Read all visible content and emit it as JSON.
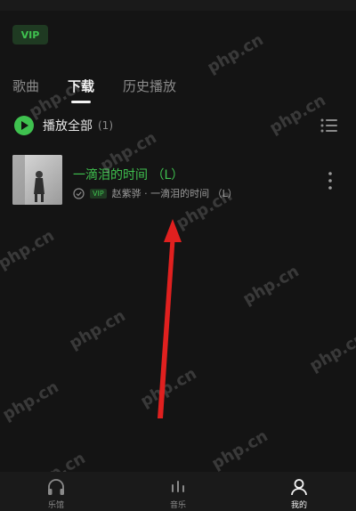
{
  "header": {
    "vip_label": "VIP"
  },
  "tabs": [
    {
      "label": "歌曲"
    },
    {
      "label": "下载"
    },
    {
      "label": "历史播放"
    }
  ],
  "play_all": {
    "label": "播放全部",
    "count": "(1)"
  },
  "song": {
    "title": "一滴泪的时间 （L）",
    "vip_tag": "VIP",
    "subtitle": "赵紫骅 · 一滴泪的时间 （L）"
  },
  "watermark": {
    "text": "php.cn"
  },
  "nav": [
    {
      "label": "乐馆",
      "icon": "headphones-icon"
    },
    {
      "label": "音乐",
      "icon": "equalizer-icon"
    },
    {
      "label": "我的",
      "icon": "person-icon"
    }
  ],
  "colors": {
    "accent": "#3fc14f",
    "background": "#141414",
    "arrow": "#e0201f"
  }
}
